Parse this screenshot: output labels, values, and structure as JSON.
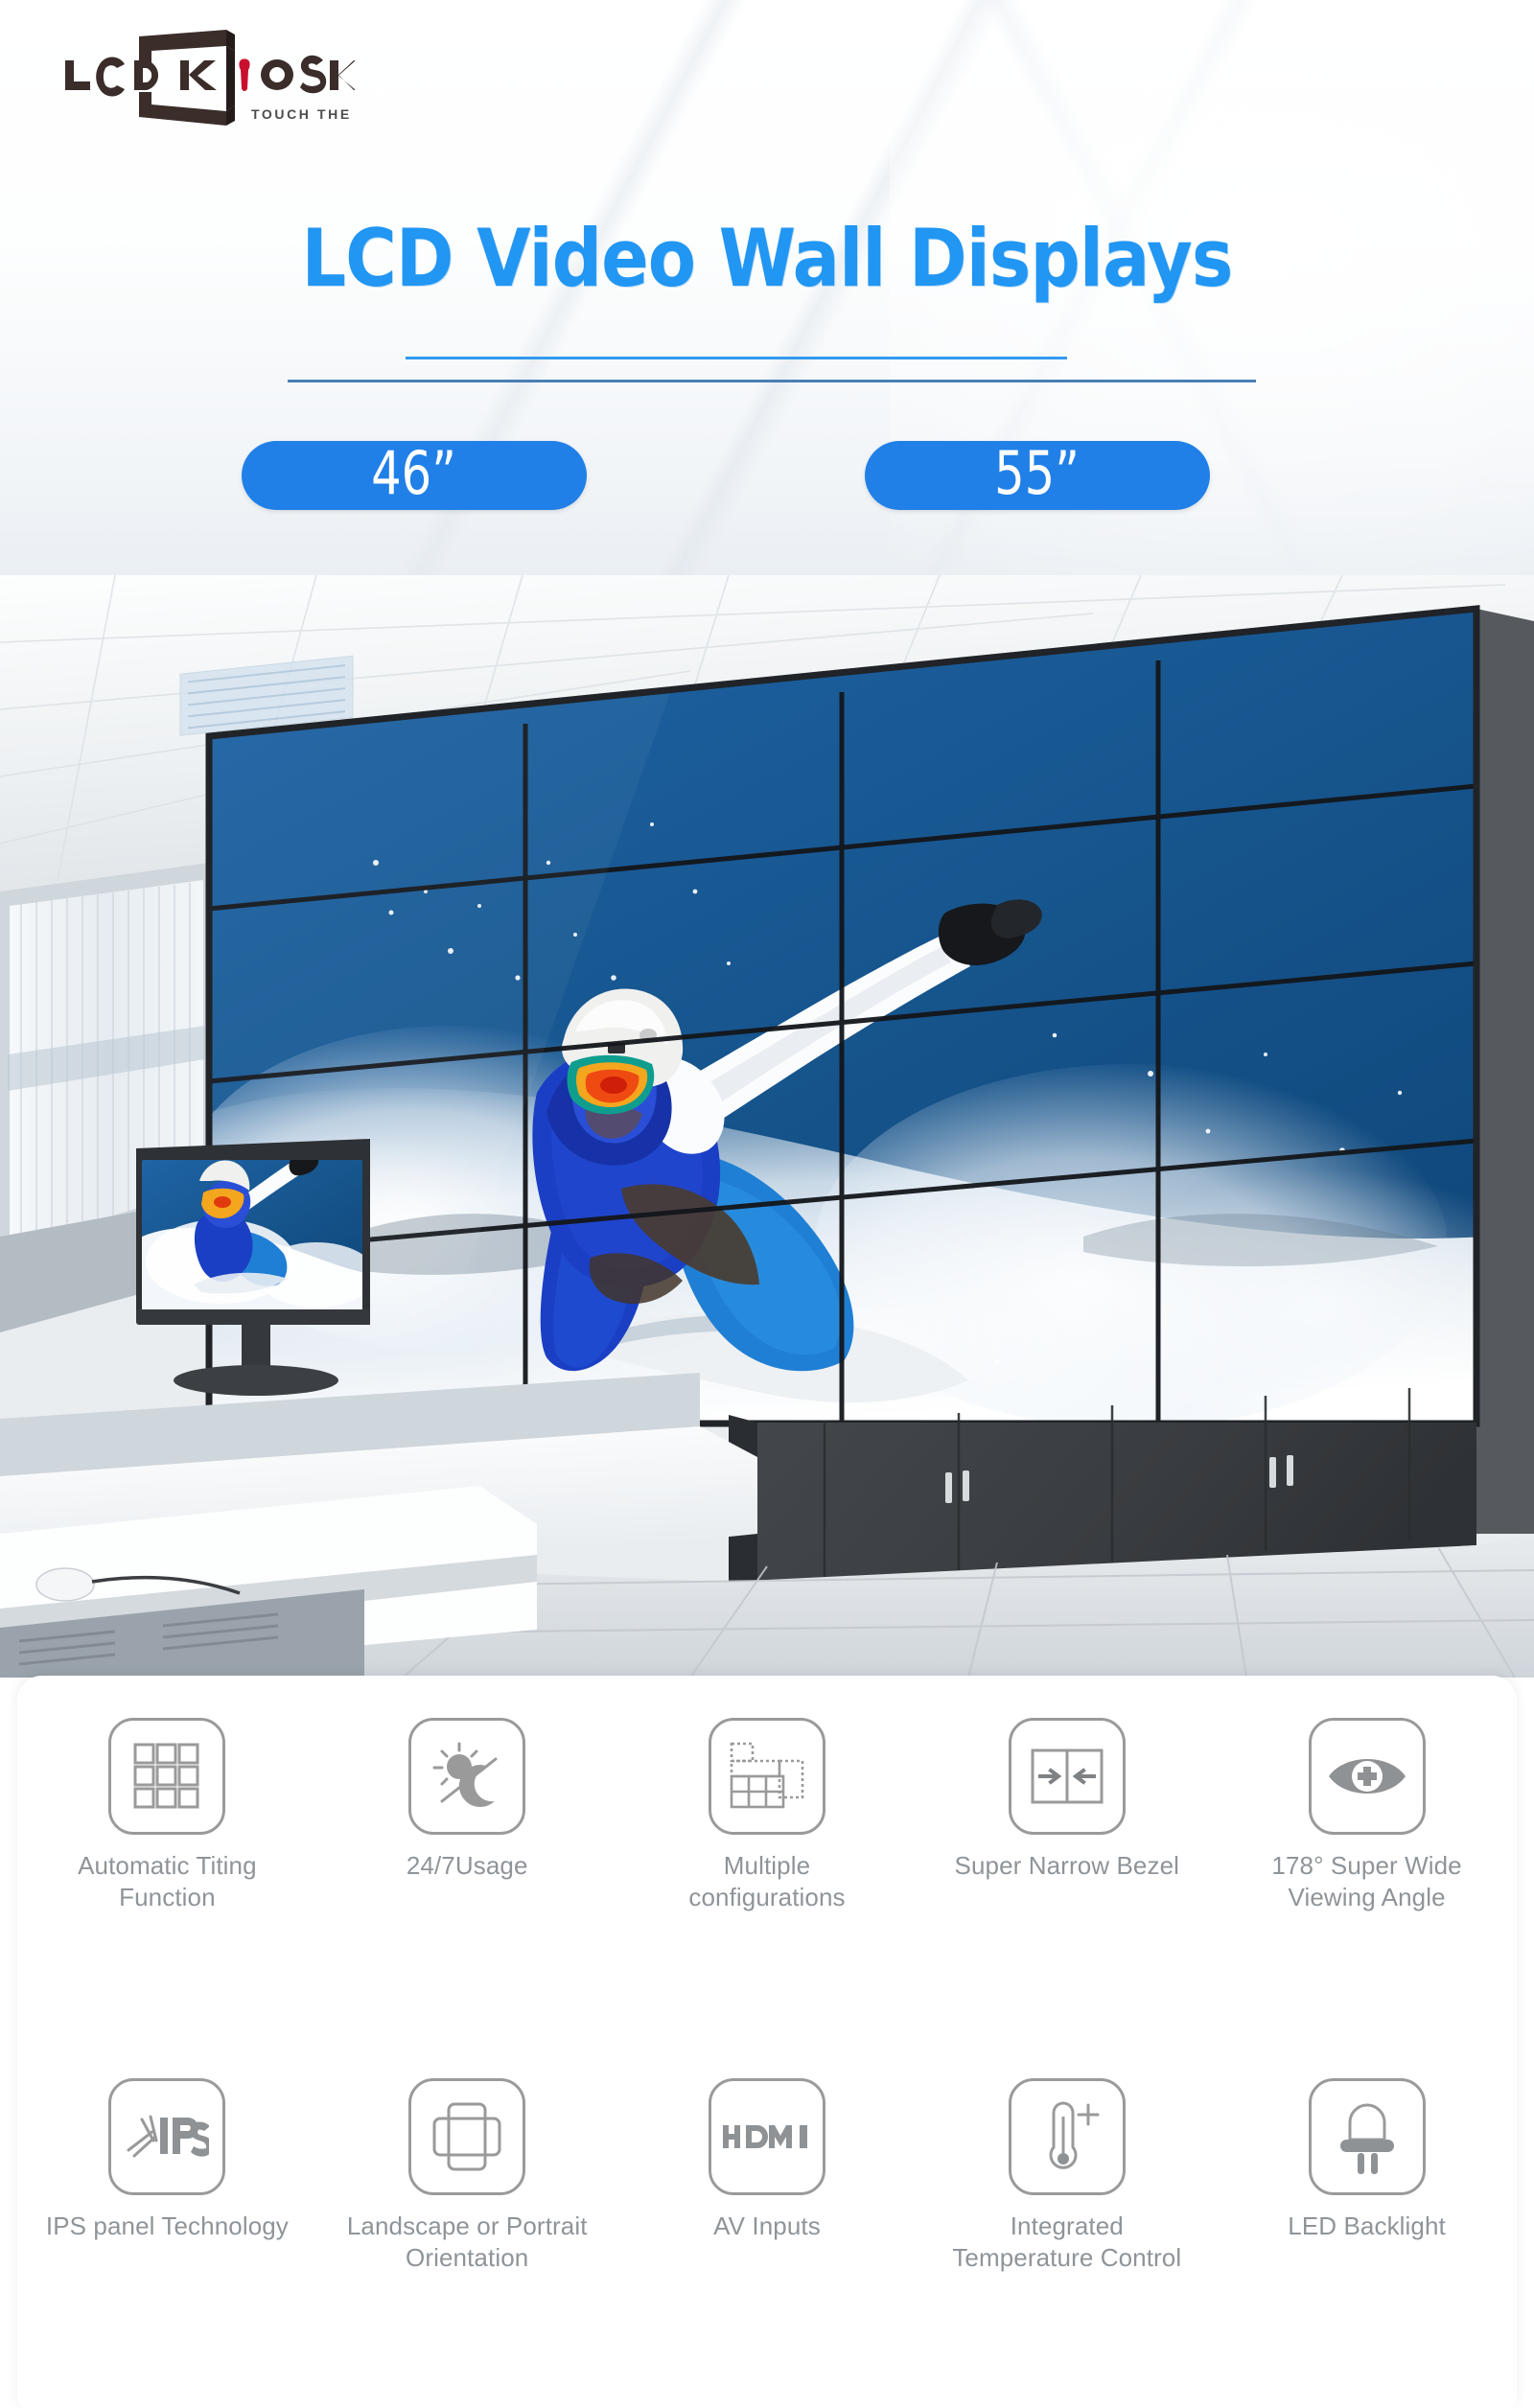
{
  "brand": {
    "logo_text": "LCDKiOSK",
    "logo_letters": [
      "L",
      "C",
      "D",
      "K",
      "i",
      "O",
      "S",
      "K"
    ],
    "tagline": "TOUCH THE FUTURE",
    "accent_color": "#c8102e",
    "logo_color": "#3a2d2a"
  },
  "header": {
    "title": "LCD Video Wall Displays",
    "title_color": "#2196f3",
    "rule_color_top": "#3399ee",
    "rule_color_bottom": "#4a7fb5",
    "badge_color": "#2080e8",
    "badges": [
      {
        "label": "46”",
        "name": "size-46"
      },
      {
        "label": "55”",
        "name": "size-55"
      }
    ]
  },
  "scene": {
    "description": "Control room with LCD video wall",
    "videowall": {
      "columns": 4,
      "rows": 4,
      "bezel_color": "#1a1d21",
      "content": "snowboarder carving through snow spray on deep blue sky"
    },
    "colors": {
      "sky_blue": "#1a5e9e",
      "sky_blue_dark": "#0f4d86",
      "snow_white": "#f2f6fa",
      "jacket_blue": "#1a3fc4",
      "pants_blue": "#1f7fd4",
      "helmet_white": "#f0f0ee",
      "goggle_orange": "#f04a10",
      "cabinet_dark": "#3b3e42",
      "floor_tile": "#e4e7ea",
      "ceiling_tile": "#f4f6f7",
      "blinds_white": "#eef2f5",
      "desk_white": "#f7f9fa"
    }
  },
  "features": {
    "icon_stroke": "#9a9a9a",
    "label_color": "#8f9499",
    "row1": [
      {
        "label": "Automatic Titing Function",
        "icon": "grid-3x3-icon",
        "name": "feature-automatic-tiling"
      },
      {
        "label": "24/7Usage",
        "icon": "sun-moon-icon",
        "name": "feature-24-7-usage"
      },
      {
        "label": "Multiple configurations",
        "icon": "multi-config-icon",
        "name": "feature-multiple-configurations"
      },
      {
        "label": "Super Narrow Bezel",
        "icon": "narrow-bezel-icon",
        "name": "feature-super-narrow-bezel"
      },
      {
        "label": "178° Super Wide Viewing Angle",
        "icon": "eye-plus-icon",
        "name": "feature-viewing-angle"
      }
    ],
    "row2": [
      {
        "label": "IPS panel Technology",
        "icon": "ips-icon",
        "name": "feature-ips-panel"
      },
      {
        "label": "Landscape or Portrait Orientation",
        "icon": "orientation-icon",
        "name": "feature-orientation"
      },
      {
        "label": "AV Inputs",
        "icon": "hdmi-icon",
        "name": "feature-av-inputs"
      },
      {
        "label": "Integrated Temperature Control",
        "icon": "thermometer-icon",
        "name": "feature-temperature-control"
      },
      {
        "label": "LED Backlight",
        "icon": "led-bulb-icon",
        "name": "feature-led-backlight"
      }
    ]
  }
}
